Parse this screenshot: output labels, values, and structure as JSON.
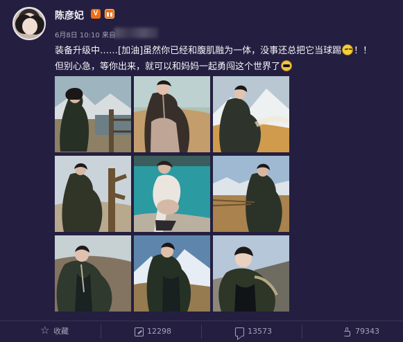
{
  "author": {
    "name": "陈彦妃"
  },
  "post": {
    "date_text": "6月8日 10:10 来自",
    "text_lines": [
      "装备升级中……[加油]虽然你已经和腹肌融为一体，没事还总把它当球踢",
      "但别心急，等你出来，就可以和妈妈一起勇闯这个世界了"
    ],
    "line1_suffix": "！！",
    "emoji_icons": [
      "smirk-emoji-icon",
      "sunglasses-emoji-icon"
    ]
  },
  "photos": [
    {
      "theme": "mountain-fence-standing"
    },
    {
      "theme": "lace-jacket-hay-field"
    },
    {
      "theme": "snow-mountain-sitting"
    },
    {
      "theme": "fence-post-pose"
    },
    {
      "theme": "lake-pregnancy"
    },
    {
      "theme": "dry-field-crouch"
    },
    {
      "theme": "portrait-open-jacket"
    },
    {
      "theme": "mountain-portrait"
    },
    {
      "theme": "updo-smile"
    }
  ],
  "actions": [
    {
      "name": "collect",
      "label": "收藏",
      "icon": "star-icon"
    },
    {
      "name": "repost",
      "label": "12298",
      "icon": "repost-icon"
    },
    {
      "name": "comment",
      "label": "13573",
      "icon": "comment-icon"
    },
    {
      "name": "like",
      "label": "79343",
      "icon": "thumbs-up-icon"
    }
  ],
  "colors": {
    "background": "#241f40",
    "text": "#f4f4f8",
    "muted": "#a7a7b6",
    "badge": "#f06f13"
  }
}
